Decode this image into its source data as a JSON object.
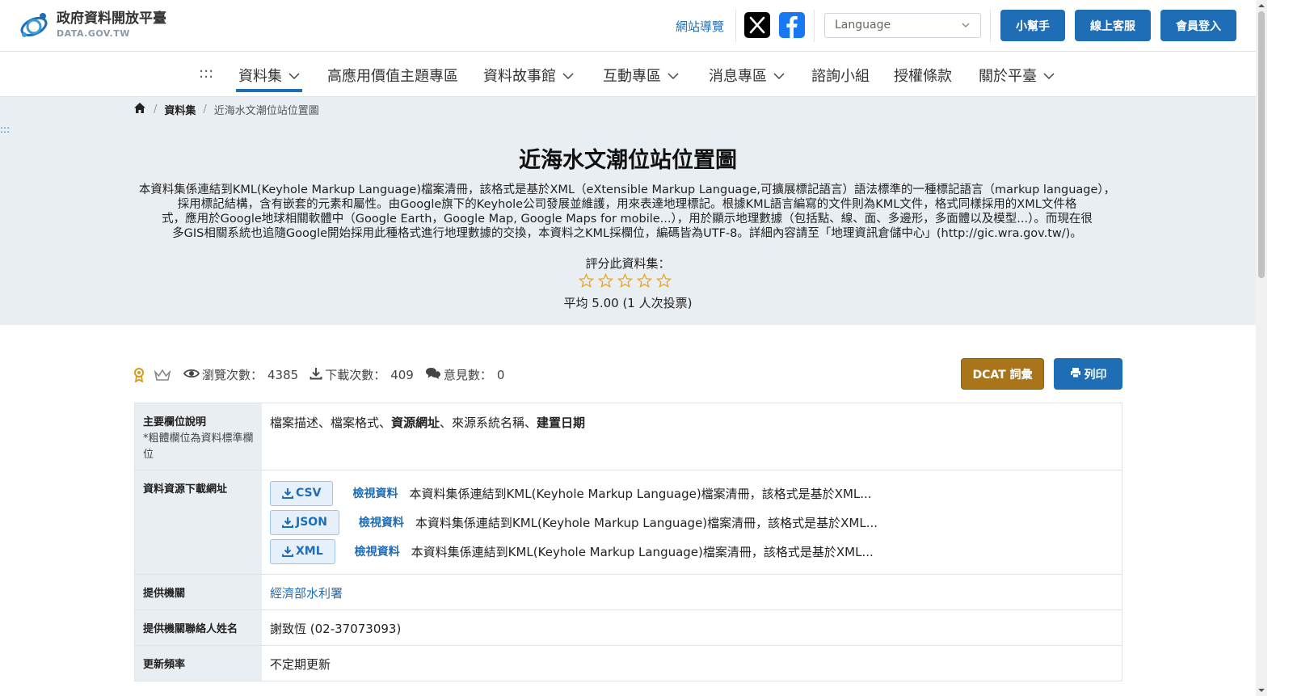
{
  "header": {
    "logo_zh": "政府資料開放平臺",
    "logo_en": "DATA.GOV.TW",
    "sitemap_link": "網站導覽",
    "language_placeholder": "Language",
    "helper_button": "小幫手",
    "service_button": "線上客服",
    "login_button": "會員登入"
  },
  "nav": {
    "skip": ":::",
    "items": [
      {
        "label": "資料集",
        "has_menu": true,
        "active": true
      },
      {
        "label": "高應用價值主題專區",
        "has_menu": false
      },
      {
        "label": "資料故事館",
        "has_menu": true
      },
      {
        "label": "互動專區",
        "has_menu": true
      },
      {
        "label": "消息專區",
        "has_menu": true
      },
      {
        "label": "諮詢小組",
        "has_menu": false
      },
      {
        "label": "授權條款",
        "has_menu": false
      },
      {
        "label": "關於平臺",
        "has_menu": true
      }
    ]
  },
  "breadcrumb": {
    "level1": "資料集",
    "current": "近海水文潮位站位置圖"
  },
  "skip_anchor": ":::",
  "dataset": {
    "title": "近海水文潮位站位置圖",
    "description_lines": [
      "本資料集係連結到KML(Keyhole Markup Language)檔案清冊，該格式是基於XML（eXtensible Markup Language,可擴展標記語言）語法標準的一種標記語言（markup language），",
      "採用標記結構，含有嵌套的元素和屬性。由Google旗下的Keyhole公司發展並維護，用來表達地理標記。根據KML語言編寫的文件則為KML文件，格式同樣採用的XML文件格",
      "式，應用於Google地球相關軟體中（Google Earth，Google Map, Google Maps for mobile...），用於顯示地理數據（包括點、線、面、多邊形，多面體以及模型...）。而現在很",
      "多GIS相關系統也追隨Google開始採用此種格式進行地理數據的交換，本資料之KML採欄位，編碼皆為UTF-8。詳細內容請至「地理資訊倉儲中心」(http://gic.wra.gov.tw/)。"
    ],
    "rate_label": "評分此資料集：",
    "rating_stars_filled": 0,
    "rating_stars_total": 5,
    "average_text": "平均 5.00 (1 人次投票)"
  },
  "stats": {
    "views_label": "瀏覽次數：",
    "views": "4385",
    "downloads_label": "下載次數：",
    "downloads": "409",
    "comments_label": "意見數：",
    "comments": "0"
  },
  "actions": {
    "dcat": "DCAT 詞彙",
    "print": "列印"
  },
  "table": {
    "fields_key": "主要欄位說明",
    "fields_note": "*粗體欄位為資料標準欄位",
    "fields_value_parts": [
      {
        "text": "檔案描述、檔案格式、",
        "bold": false
      },
      {
        "text": "資源網址",
        "bold": true
      },
      {
        "text": "、來源系統名稱、",
        "bold": false
      },
      {
        "text": "建置日期",
        "bold": true
      }
    ],
    "downloads_key": "資料資源下載網址",
    "resources": [
      {
        "format": "CSV",
        "view": "檢視資料",
        "desc": "本資料集係連結到KML(Keyhole Markup Language)檔案清冊，該格式是基於XML..."
      },
      {
        "format": "JSON",
        "view": "檢視資料",
        "desc": "本資料集係連結到KML(Keyhole Markup Language)檔案清冊，該格式是基於XML..."
      },
      {
        "format": "XML",
        "view": "檢視資料",
        "desc": "本資料集係連結到KML(Keyhole Markup Language)檔案清冊，該格式是基於XML..."
      }
    ],
    "agency_key": "提供機關",
    "agency_value": "經濟部水利署",
    "contact_key": "提供機關聯絡人姓名",
    "contact_value": "謝致恆 (02-37073093)",
    "frequency_key": "更新頻率",
    "frequency_value": "不定期更新"
  },
  "colors": {
    "primary": "#1f6db5",
    "dcat": "#a9741a",
    "hero_bg": "#e9eef2",
    "star": "#e8a317"
  }
}
